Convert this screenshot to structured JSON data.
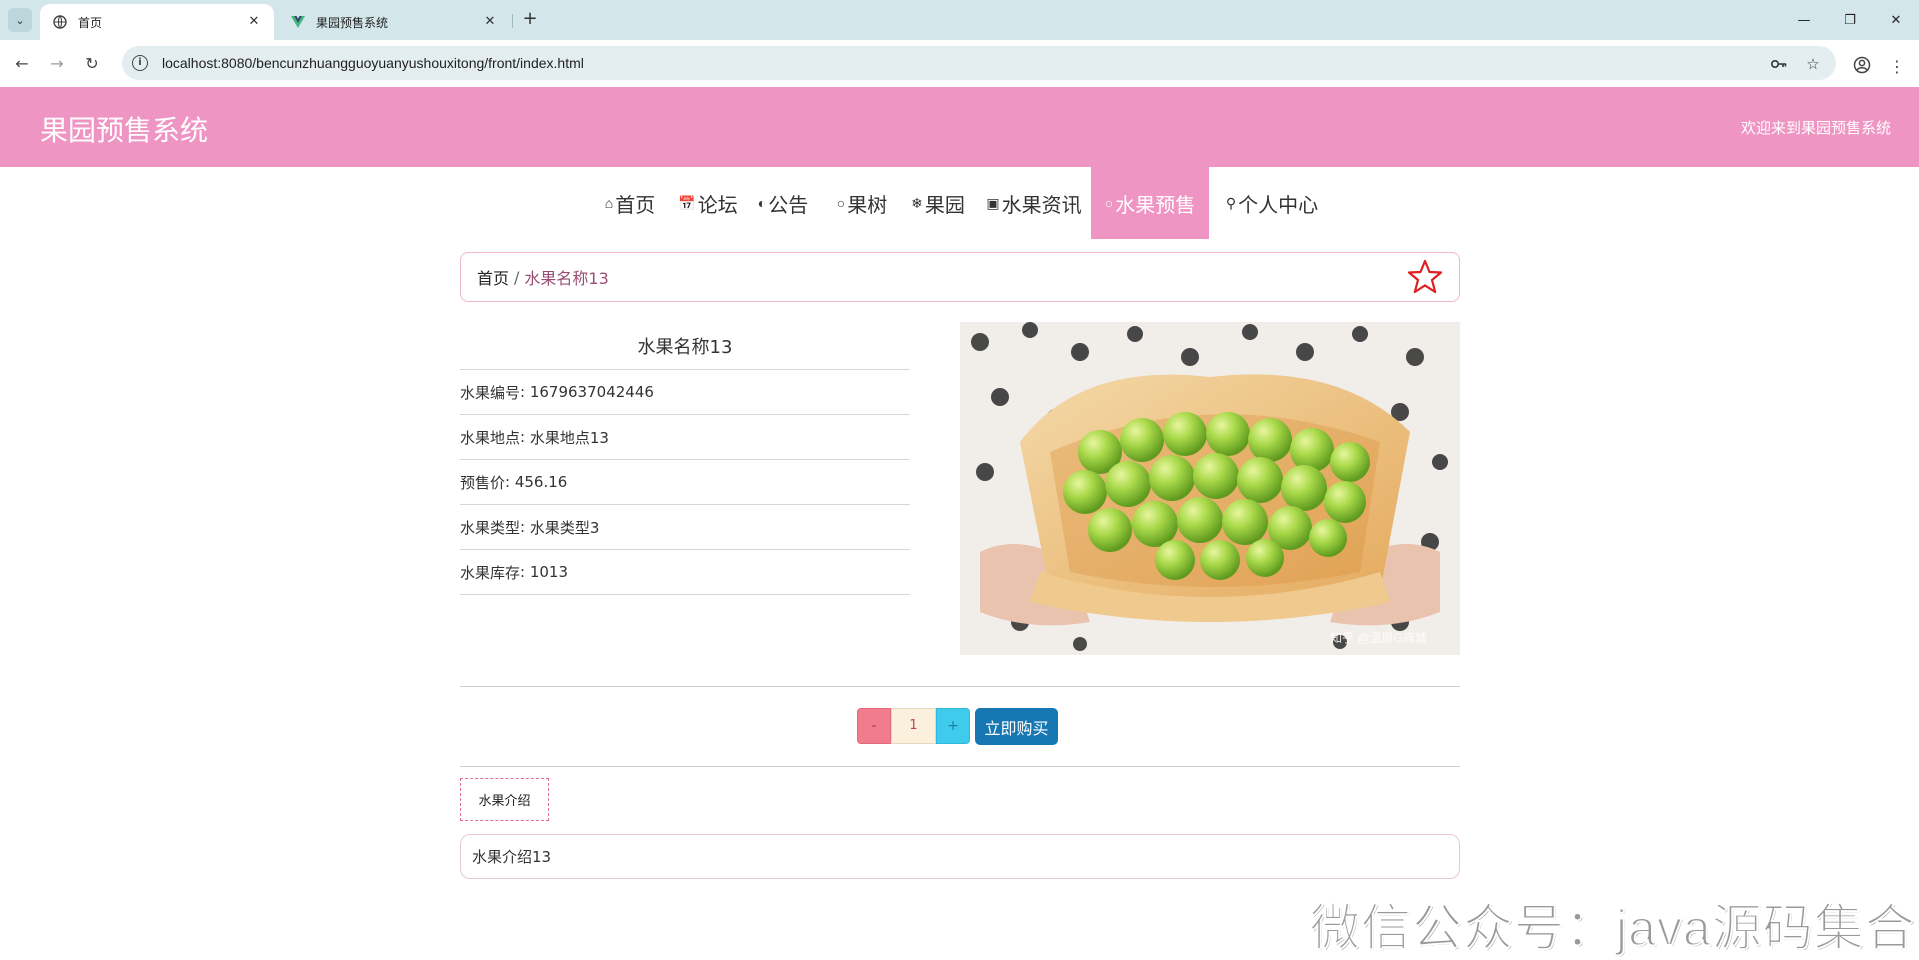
{
  "browser": {
    "tabs": [
      {
        "title": "首页",
        "active": true
      },
      {
        "title": "果园预售系统",
        "active": false
      }
    ],
    "url": "localhost:8080/bencunzhuangguoyuanyushouxitong/front/index.html"
  },
  "header": {
    "site_title": "果园预售系统",
    "welcome": "欢迎来到果园预售系统"
  },
  "nav": {
    "items": [
      {
        "icon": "home-icon",
        "label": "首页"
      },
      {
        "icon": "calendar-icon",
        "label": "论坛"
      },
      {
        "icon": "palette-icon",
        "label": "公告"
      },
      {
        "icon": "circle-icon",
        "label": "果树"
      },
      {
        "icon": "snowflake-icon",
        "label": "果园"
      },
      {
        "icon": "gift-icon",
        "label": "水果资讯"
      },
      {
        "icon": "cart-icon",
        "label": "水果预售"
      },
      {
        "icon": "user-icon",
        "label": "个人中心"
      }
    ],
    "active_index": 6
  },
  "breadcrumb": {
    "home": "首页",
    "separator": "/",
    "current": "水果名称13"
  },
  "detail": {
    "title": "水果名称13",
    "fields": [
      {
        "label": "水果编号",
        "value": "1679637042446"
      },
      {
        "label": "水果地点",
        "value": "水果地点13"
      },
      {
        "label": "预售价",
        "value": "456.16"
      },
      {
        "label": "水果类型",
        "value": "水果类型3"
      },
      {
        "label": "水果库存",
        "value": "1013"
      }
    ],
    "image_watermark": "知乎 @温原G商城"
  },
  "purchase": {
    "minus": "-",
    "quantity": "1",
    "plus": "+",
    "buy_label": "立即购买"
  },
  "intro": {
    "tab_label": "水果介绍",
    "content": "水果介绍13"
  },
  "overlay_watermark": "微信公众号：java源码集合",
  "colors": {
    "header_bg": "#ef95c3",
    "buy_button": "#1677b3",
    "minus_button": "#f07c8c",
    "plus_button": "#3fcbec",
    "star": "#e02020"
  }
}
